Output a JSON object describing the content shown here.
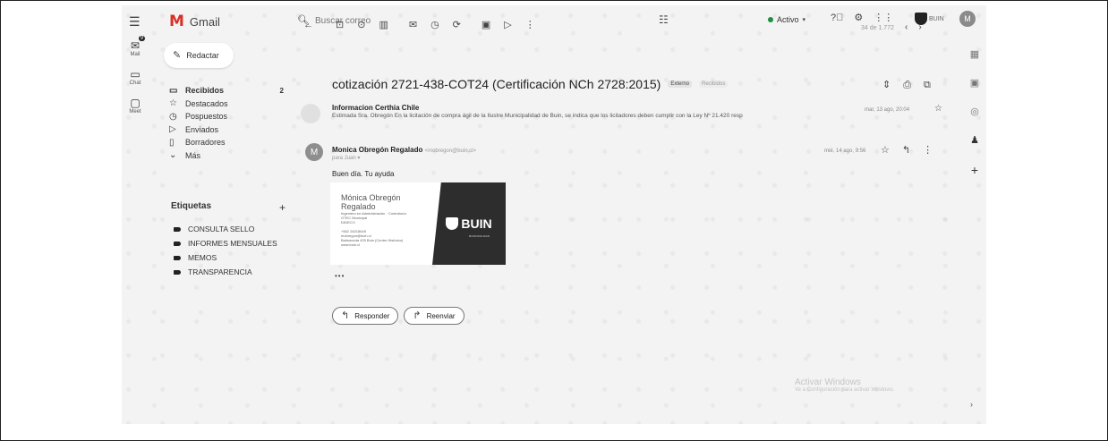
{
  "app": {
    "name": "Gmail"
  },
  "header": {
    "search_placeholder": "Buscar correo",
    "status": "Activo",
    "org_logo_text": "BUIN",
    "avatar_initial": "M"
  },
  "rail": {
    "items": [
      {
        "label": "Mail",
        "badge": "9",
        "icon": "mail-icon"
      },
      {
        "label": "Chat",
        "icon": "chat-icon"
      },
      {
        "label": "Meet",
        "icon": "video-icon"
      }
    ]
  },
  "sidebar": {
    "compose_label": "Redactar",
    "nav": [
      {
        "label": "Recibidos",
        "count": "2",
        "icon": "inbox-icon",
        "active": true
      },
      {
        "label": "Destacados",
        "icon": "star-icon"
      },
      {
        "label": "Pospuestos",
        "icon": "clock-icon"
      },
      {
        "label": "Enviados",
        "icon": "send-icon"
      },
      {
        "label": "Borradores",
        "icon": "draft-icon"
      },
      {
        "label": "Más",
        "icon": "chevron-down-icon"
      }
    ],
    "labels_title": "Etiquetas",
    "labels": [
      "CONSULTA SELLO",
      "INFORMES MENSUALES",
      "MEMOS",
      "TRANSPARENCIA"
    ]
  },
  "toolbar": {
    "pager_text": "34 de 1.772"
  },
  "thread": {
    "subject": "cotización 2721-438-COT24 (Certificación NCh 2728:2015)",
    "chips": [
      "Externo",
      "Recibidos"
    ],
    "messages": [
      {
        "sender": "Informacion Certhia Chile",
        "snippet": "Estimada Sra. Obregón En la licitación de compra ágil de la Ilustre Municipalidad de Buin, se indica que los licitadores deben cumplir con la Ley Nº 21.420 resp",
        "date": "mar, 13 ago, 20:04"
      },
      {
        "sender": "Monica Obregón Regalado",
        "email": "<mobregon@buin.cl>",
        "to": "para Juan",
        "date": "mié, 14 ago, 9:56",
        "avatar_initial": "M",
        "body": "Buen día. Tu ayuda"
      }
    ],
    "signature": {
      "name": "Mónica Obregón Regalado",
      "lines": [
        "Ingeniero en Administración · Contraloría",
        "OTEC Municipal",
        "DIDECO",
        "",
        "+562 28218649",
        "mobregon@buin.cl",
        "Balmaceda 425 Buin (Centro Histórico)",
        "www.buin.cl"
      ],
      "org": "BUIN",
      "org_sub": "MUNICIPALIDAD"
    },
    "reply_label": "Responder",
    "forward_label": "Reenviar"
  },
  "watermark": {
    "title": "Activar Windows",
    "subtitle": "Ve a Configuración para activar Windows."
  }
}
